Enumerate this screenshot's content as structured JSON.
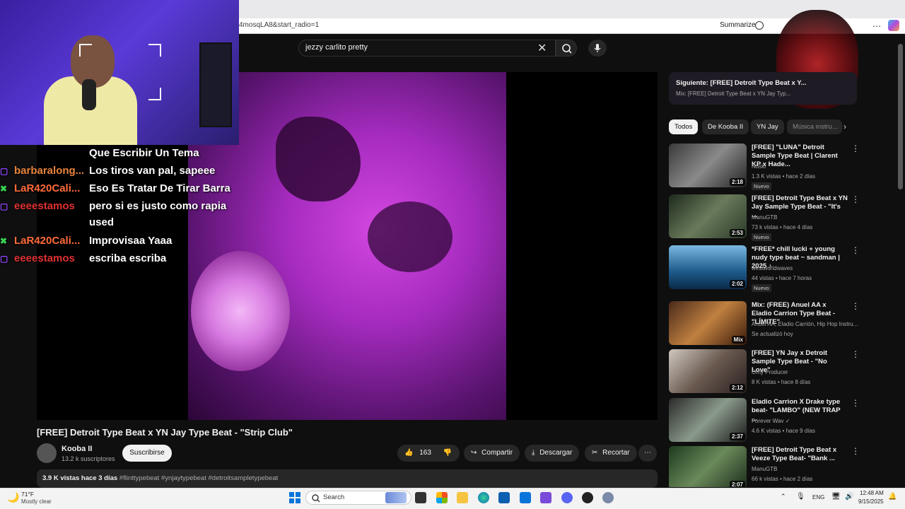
{
  "browser": {
    "url_fragment": "4mosqLA8&start_radio=1",
    "summarize_label": "Summarize"
  },
  "youtube": {
    "search_value": "jezzy carlito pretty"
  },
  "chat": [
    {
      "user": "",
      "message": "Que Escribir Un Tema",
      "color": "#ffffff",
      "badge": ""
    },
    {
      "user": "barbaralong...",
      "message": "Los tiros van pal, sapeee",
      "color": "#e8843c",
      "badge": "twitch"
    },
    {
      "user": "LaR420Cali...",
      "message": "Eso Es Tratar De Tirar Barra",
      "color": "#ff6a3a",
      "badge": "x"
    },
    {
      "user": "eeeestamos",
      "message": "pero si es justo como rapia",
      "color": "#e03030",
      "badge": "twitch"
    },
    {
      "user": "",
      "message": "used",
      "color": "#ffffff",
      "badge": ""
    },
    {
      "user": "LaR420Cali...",
      "message": "Improvisaa Yaaa",
      "color": "#ff6a3a",
      "badge": "x"
    },
    {
      "user": "eeeestamos",
      "message": "escriba escriba",
      "color": "#e03030",
      "badge": "twitch"
    }
  ],
  "video": {
    "title": "[FREE] Detroit Type Beat x YN Jay Type Beat - \"Strip Club\"",
    "channel": "Kooba II",
    "subscribers": "13.2 k suscriptores",
    "subscribe_label": "Suscribirse",
    "likes": "163",
    "share_label": "Compartir",
    "download_label": "Descargar",
    "clip_label": "Recortar",
    "views_date": "3.9 K vistas  hace 3 días",
    "hashtags": "#flinttypebeat #ynjaytypebeat #detroitsampletypebeat"
  },
  "sidebar": {
    "next_title": "Siguiente: [FREE] Detroit Type Beat x Y...",
    "next_sub": "Mix: [FREE] Detroit Type Beat x YN Jay Typ...",
    "chips": [
      "Todos",
      "De Kooba II",
      "YN Jay",
      "Música instru..."
    ],
    "recommendations": [
      {
        "title": "[FREE] \"LUNA\" Detroit Sample Type Beat | Clarent KP x Hade...",
        "channel": "Nuski",
        "meta": "1.3 K vistas • hace 2 días",
        "badge": "Nuevo",
        "duration": "2:18"
      },
      {
        "title": "[FREE] Detroit Type Beat x YN Jay Sample Type Beat - \"It's ...",
        "channel": "ManuGTB",
        "meta": "73 k vistas • hace 4 días",
        "badge": "Nuevo",
        "duration": "2:53"
      },
      {
        "title": "*FREE* chill lucki + young nudy type beat ~ sandman | 2025 ♪",
        "channel": "westworldwaves",
        "meta": "44 vistas • hace 7 horas",
        "badge": "Nuevo",
        "duration": "2:02"
      },
      {
        "title": "Mix: (FREE) Anuel AA x Eladio Carrion Type Beat - \"LÍMITE\"",
        "channel": "Anuel AA, Eladio Carrión, Hip Hop Instru...",
        "meta": "Se actualizó hoy",
        "badge": "",
        "duration": "Mix"
      },
      {
        "title": "[FREE] YN Jay x Detroit Sample Type Beat - \"No Love\"",
        "channel": "Omy Producer",
        "meta": "8 K vistas • hace 8 días",
        "badge": "",
        "duration": "2:12"
      },
      {
        "title": "Eladio Carrion X Drake type beat- \"LAMBO\" (NEW TRAP ...",
        "channel": "Forever Wav ✓",
        "meta": "4.6 K vistas • hace 9 días",
        "badge": "",
        "duration": "2:37"
      },
      {
        "title": "[FREE] Detroit Type Beat x Veeze Type Beat- \"Bank ...",
        "channel": "ManuGTB",
        "meta": "66 k vistas • hace 2 días",
        "badge": "",
        "duration": "2:07"
      }
    ]
  },
  "taskbar": {
    "temp": "71°F",
    "weather": "Mostly clear",
    "search_label": "Search",
    "lang": "ENG",
    "time": "12:48 AM",
    "date": "9/15/2025"
  }
}
